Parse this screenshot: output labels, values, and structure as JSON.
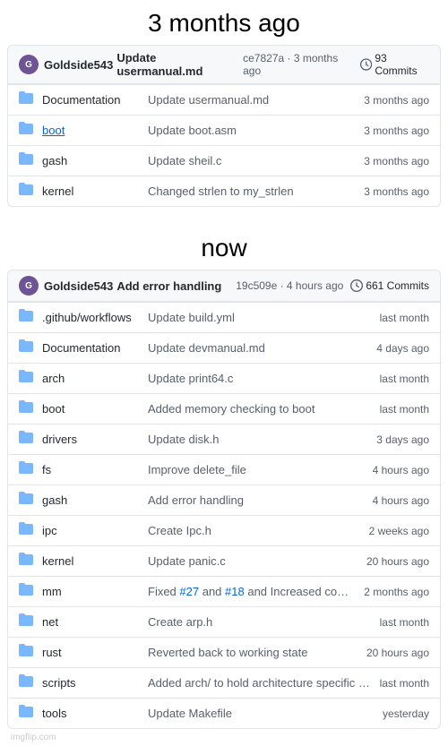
{
  "sections": [
    {
      "title": "3 months ago",
      "header": {
        "user": "Goldside543",
        "message": "Update usermanual.md",
        "sha": "ce7827a",
        "time": "3 months ago",
        "commits": "93 Commits"
      },
      "files": [
        {
          "name": "Documentation",
          "commit": "Update usermanual.md",
          "time": "3 months ago",
          "link": false
        },
        {
          "name": "boot",
          "commit": "Update boot.asm",
          "time": "3 months ago",
          "link": true
        },
        {
          "name": "gash",
          "commit": "Update sheil.c",
          "time": "3 months ago",
          "link": false
        },
        {
          "name": "kernel",
          "commit": "Changed strlen to my_strlen",
          "time": "3 months ago",
          "link": false
        }
      ]
    },
    {
      "title": "now",
      "header": {
        "user": "Goldside543",
        "message": "Add error handling",
        "sha": "19c509e",
        "time": "4 hours ago",
        "commits": "661 Commits"
      },
      "files": [
        {
          "name": ".github/workflows",
          "commit": "Update build.yml",
          "time": "last month",
          "link": false
        },
        {
          "name": "Documentation",
          "commit": "Update devmanual.md",
          "time": "4 days ago",
          "link": false
        },
        {
          "name": "arch",
          "commit": "Update print64.c",
          "time": "last month",
          "link": false
        },
        {
          "name": "boot",
          "commit": "Added memory checking to boot",
          "time": "last month",
          "link": false
        },
        {
          "name": "drivers",
          "commit": "Update disk.h",
          "time": "3 days ago",
          "link": false
        },
        {
          "name": "fs",
          "commit": "Improve delete_file",
          "time": "4 hours ago",
          "link": false
        },
        {
          "name": "gash",
          "commit": "Add error handling",
          "time": "4 hours ago",
          "link": false
        },
        {
          "name": "ipc",
          "commit": "Create Ipc.h",
          "time": "2 weeks ago",
          "link": false
        },
        {
          "name": "kernel",
          "commit": "Update panic.c",
          "time": "20 hours ago",
          "link": false
        },
        {
          "name": "mm",
          "commit_parts": [
            "Fixed ",
            "#27",
            " and ",
            "#18",
            " and Increased compatibility"
          ],
          "time": "2 months ago",
          "link": false,
          "special": true
        },
        {
          "name": "net",
          "commit": "Create arp.h",
          "time": "last month",
          "link": false
        },
        {
          "name": "rust",
          "commit": "Reverted back to working state",
          "time": "20 hours ago",
          "link": false
        },
        {
          "name": "scripts",
          "commit": "Added arch/ to hold architecture specific code",
          "time": "last month",
          "link": false
        },
        {
          "name": "tools",
          "commit": "Update Makefile",
          "time": "yesterday",
          "link": false
        }
      ]
    }
  ],
  "watermark": "imgflip.com"
}
